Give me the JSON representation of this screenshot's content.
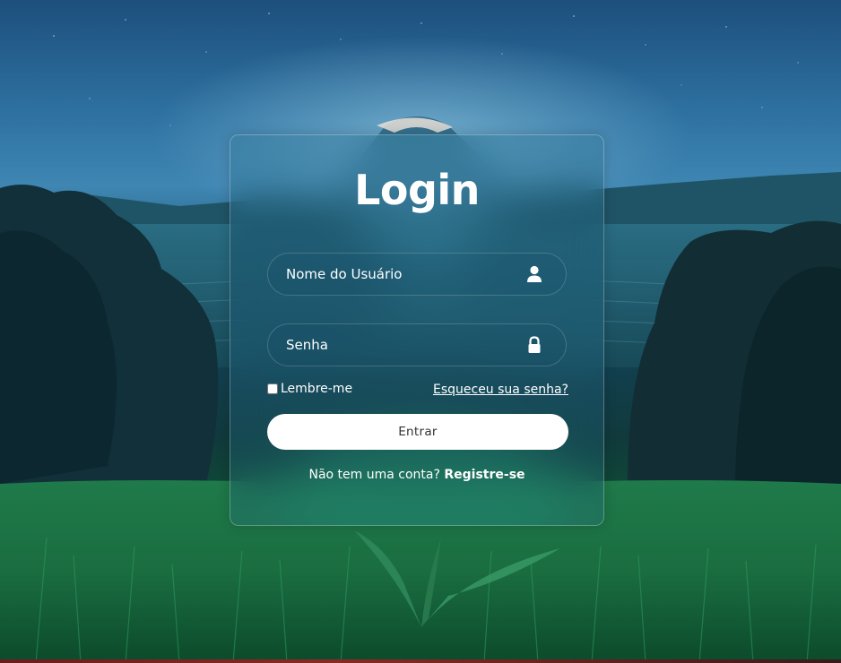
{
  "form": {
    "title": "Login",
    "username": {
      "placeholder": "Nome do Usuário",
      "value": "",
      "icon": "user-icon"
    },
    "password": {
      "placeholder": "Senha",
      "value": "",
      "icon": "lock-icon"
    },
    "remember_label": "Lembre-me",
    "remember_checked": false,
    "forgot_label": "Esqueceu sua senha?",
    "submit_label": "Entrar",
    "register_prompt": "Não tem uma conta?",
    "register_link": "Registre-se"
  },
  "theme": {
    "card_border": "#ffffff",
    "button_bg": "#ffffff",
    "button_text": "#333333",
    "text_color": "#ffffff"
  }
}
